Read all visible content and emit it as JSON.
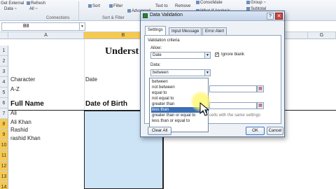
{
  "ribbon": {
    "get_external_data": "Get External",
    "get_external_data2": "Data ~",
    "refresh_all": "Refresh",
    "refresh_all2": "All ~",
    "sort": "Sort",
    "filter": "Filter",
    "advanced": "Advanced",
    "text_to": "Text to",
    "remove": "Remove",
    "consolidate": "Consolidate",
    "what_if": "What-If Analysis",
    "group": "Group ~",
    "subtotal": "Subtotal",
    "group_connections": "Connections",
    "group_sort": "Sort & Filter"
  },
  "formula_bar": {
    "name_box": "B8"
  },
  "columns": [
    "A",
    "B",
    "G"
  ],
  "rows": [
    "1",
    "2",
    "3",
    "4",
    "5",
    "6",
    "7",
    "8",
    "9",
    "10",
    "11",
    "12",
    "13",
    "14"
  ],
  "sheet": {
    "title": "Underst",
    "character_label": "Character",
    "date_label": "Date",
    "az": "A-Z",
    "full_name_header": "Full Name",
    "dob_header": "Date of Birth",
    "names": [
      "Ali",
      "Ali Khan",
      "Rashid",
      "rashid Khan"
    ]
  },
  "dialog": {
    "title": "Data Validation",
    "tabs": [
      "Settings",
      "Input Message",
      "Error Alert"
    ],
    "validation_criteria": "Validation criteria",
    "allow_label": "Allow:",
    "allow_value": "Date",
    "ignore_blank": "Ignore blank",
    "data_label": "Data:",
    "data_value": "between",
    "options": [
      "between",
      "not between",
      "equal to",
      "not equal to",
      "greater than",
      "less than",
      "greater than or equal to",
      "less than or equal to"
    ],
    "selected_option": "less than",
    "apply_text": "cells with the same settings",
    "clear_all": "Clear All",
    "ok": "OK",
    "cancel": "Cancel"
  }
}
